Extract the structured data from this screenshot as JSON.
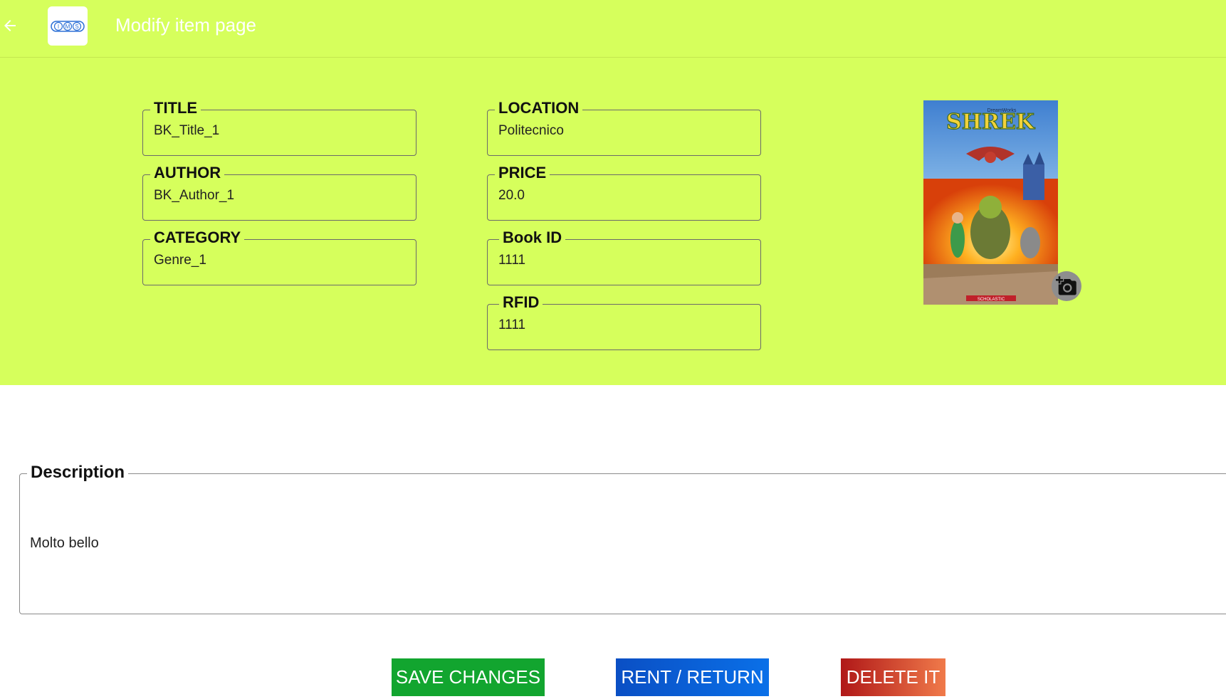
{
  "appbar": {
    "title": "Modify item page",
    "logo_text": "IMS"
  },
  "fields": {
    "title": {
      "label": "TITLE",
      "value": "BK_Title_1"
    },
    "author": {
      "label": "AUTHOR",
      "value": "BK_Author_1"
    },
    "category": {
      "label": "CATEGORY",
      "value": "Genre_1"
    },
    "location": {
      "label": "LOCATION",
      "value": "Politecnico"
    },
    "price": {
      "label": "PRICE",
      "value": "20.0"
    },
    "book_id": {
      "label": "Book ID",
      "value": "1111"
    },
    "rfid": {
      "label": "RFID",
      "value": "1111"
    }
  },
  "cover": {
    "publisher": "DreamWorks",
    "title": "SHREK",
    "imprint": "SCHOLASTIC"
  },
  "description": {
    "label": "Description",
    "value": "Molto bello"
  },
  "buttons": {
    "save": "SAVE CHANGES",
    "rent": "RENT / RETURN",
    "delete": "DELETE IT"
  },
  "colors": {
    "header_bg": "#d6ff5c",
    "save": "#12a52f",
    "rent": "#0a5fd6",
    "delete": "#c62828"
  },
  "icons": {
    "back": "arrow-left-icon",
    "camera": "camera-add-icon"
  }
}
